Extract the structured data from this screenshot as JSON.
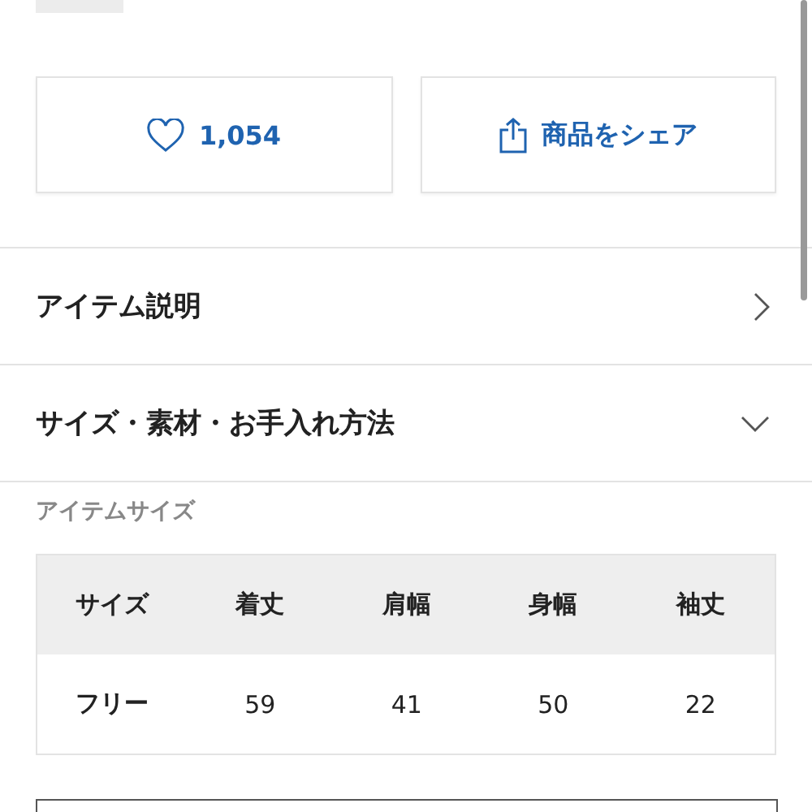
{
  "actions": [
    {
      "kind": "like",
      "label": "1,054"
    },
    {
      "kind": "share",
      "label": "商品をシェア"
    }
  ],
  "sections": [
    {
      "title": "アイテム説明",
      "expanded": false
    },
    {
      "title": "サイズ・素材・お手入れ方法",
      "expanded": true
    }
  ],
  "size_table": {
    "heading": "アイテムサイズ",
    "columns": [
      "サイズ",
      "着丈",
      "肩幅",
      "身幅",
      "袖丈"
    ],
    "rows": [
      [
        "フリー",
        "59",
        "41",
        "50",
        "22"
      ]
    ]
  }
}
